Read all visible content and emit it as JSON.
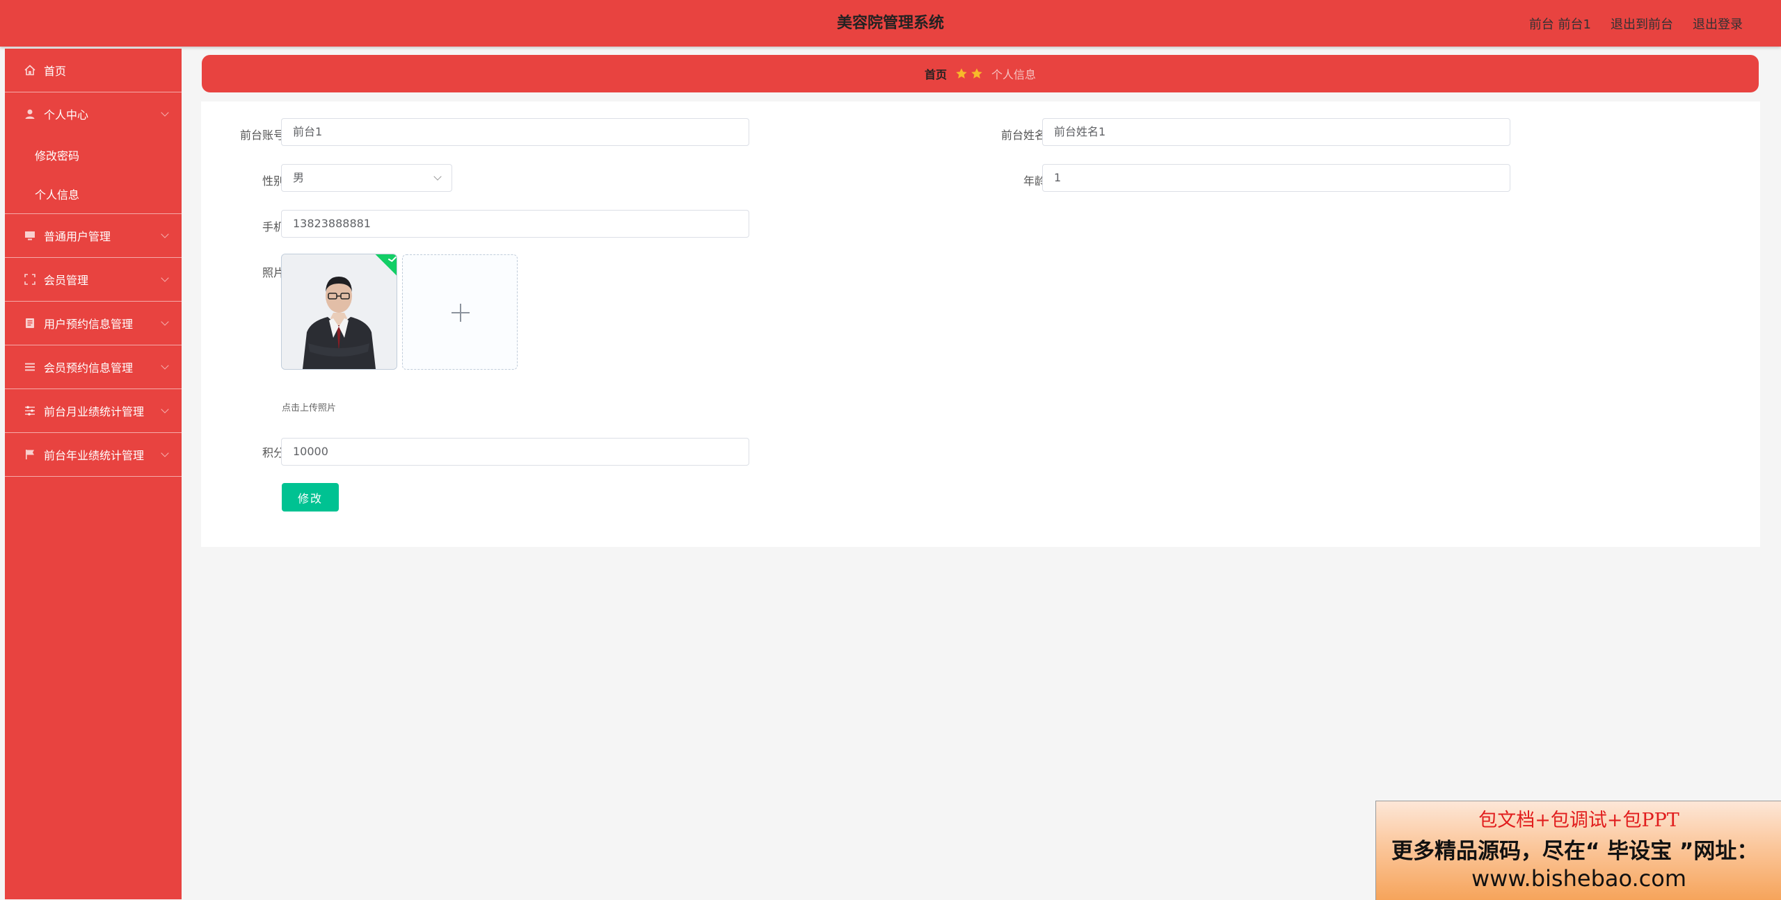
{
  "header": {
    "title": "美容院管理系统",
    "user_label": "前台 前台1",
    "to_front_label": "退出到前台",
    "logout_label": "退出登录"
  },
  "sidebar": {
    "home": "首页",
    "personal_center": "个人中心",
    "change_password": "修改密码",
    "personal_info": "个人信息",
    "items": [
      {
        "label": "普通用户管理",
        "icon": "monitor-icon"
      },
      {
        "label": "会员管理",
        "icon": "frame-icon"
      },
      {
        "label": "用户预约信息管理",
        "icon": "document-icon"
      },
      {
        "label": "会员预约信息管理",
        "icon": "list-icon"
      },
      {
        "label": "前台月业绩统计管理",
        "icon": "sliders-icon"
      },
      {
        "label": "前台年业绩统计管理",
        "icon": "flag-icon"
      }
    ]
  },
  "breadcrumb": {
    "home": "首页",
    "current": "个人信息",
    "star_color": "#f7ba2a"
  },
  "form": {
    "account_label": "前台账号",
    "account_value": "前台1",
    "name_label": "前台姓名",
    "name_value": "前台姓名1",
    "gender_label": "性别",
    "gender_value": "男",
    "age_label": "年龄",
    "age_value": "1",
    "phone_label": "手机",
    "phone_value": "13823888881",
    "photo_label": "照片",
    "upload_tip": "点击上传照片",
    "points_label": "积分",
    "points_value": "10000",
    "submit_label": "修改"
  },
  "promo": {
    "line1": "包文档+包调试+包PPT",
    "line2": "更多精品源码，尽在“ 毕设宝 ”网址：",
    "line3": "www.bishebao.com"
  },
  "colors": {
    "primary": "#e84340",
    "button": "#00c292",
    "success": "#13ce66"
  }
}
